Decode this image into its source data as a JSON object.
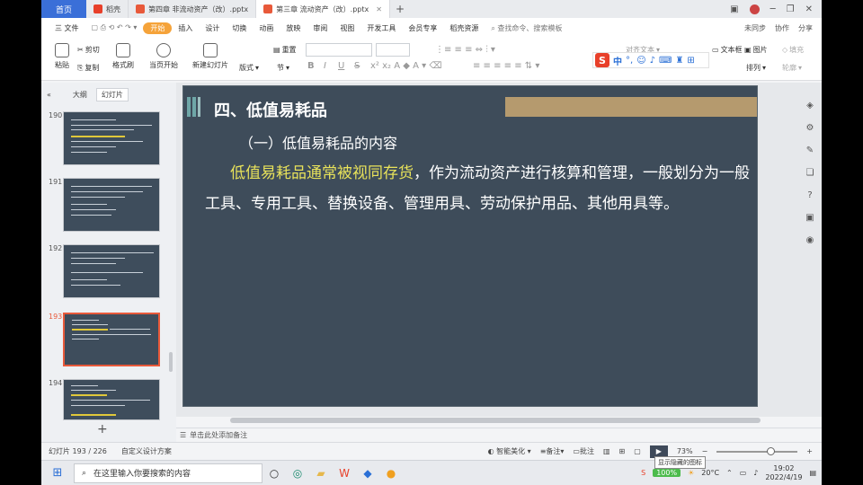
{
  "tabs": {
    "home": "首页",
    "items": [
      {
        "label": "稻壳",
        "color": "#e8402a"
      },
      {
        "label": "第四章 非流动资产（改）.pptx",
        "color": "#e8593a"
      },
      {
        "label": "第三章 流动资产（改）.pptx",
        "color": "#e8593a",
        "active": true
      }
    ],
    "new_tab": "+"
  },
  "menu": {
    "file": "三 文件",
    "items": [
      "开始",
      "插入",
      "设计",
      "切换",
      "动画",
      "放映",
      "审阅",
      "视图",
      "开发工具",
      "会员专享",
      "稻壳资源"
    ],
    "active": "开始",
    "search": "查找命令、搜索模板",
    "right": [
      "未同步",
      "协作",
      "分享"
    ]
  },
  "ribbon": {
    "paste": "粘贴",
    "cut": "剪切",
    "copy": "复制",
    "format_painter": "格式刷",
    "from_current": "当页开始",
    "new_slide": "新建幻灯片",
    "layout": "版式",
    "section": "节",
    "reset": "重置",
    "bold": "B",
    "italic": "I",
    "underline": "U",
    "strike": "S",
    "text_box": "文本框",
    "picture": "图片",
    "fill": "填充",
    "arrange": "排列",
    "outline": "轮廓",
    "align_text": "对齐文本"
  },
  "left_panel": {
    "tab_outline": "大纲",
    "tab_slides": "幻灯片",
    "thumbnails": [
      {
        "num": "190"
      },
      {
        "num": "191"
      },
      {
        "num": "192"
      },
      {
        "num": "193",
        "selected": true
      },
      {
        "num": "194"
      }
    ]
  },
  "slide": {
    "title": "四、低值易耗品",
    "subtitle": "（一）低值易耗品的内容",
    "highlight": "低值易耗品通常被视同存货",
    "body": "，作为流动资产进行核算和管理，一般划分为一般工具、专用工具、替换设备、管理用具、劳动保护用品、其他用具等。"
  },
  "notes": "单击此处添加备注",
  "status": {
    "slide_count": "幻灯片 193 / 226",
    "theme": "自定义设计方案",
    "beautify": "智能美化",
    "notes": "备注",
    "comments": "批注",
    "zoom": "73%"
  },
  "taskbar": {
    "search_placeholder": "在这里输入你要搜索的内容",
    "battery": "100%",
    "temperature": "20°C",
    "tooltip": "显示隐藏的图标",
    "time": "19:02",
    "date": "2022/4/19"
  }
}
